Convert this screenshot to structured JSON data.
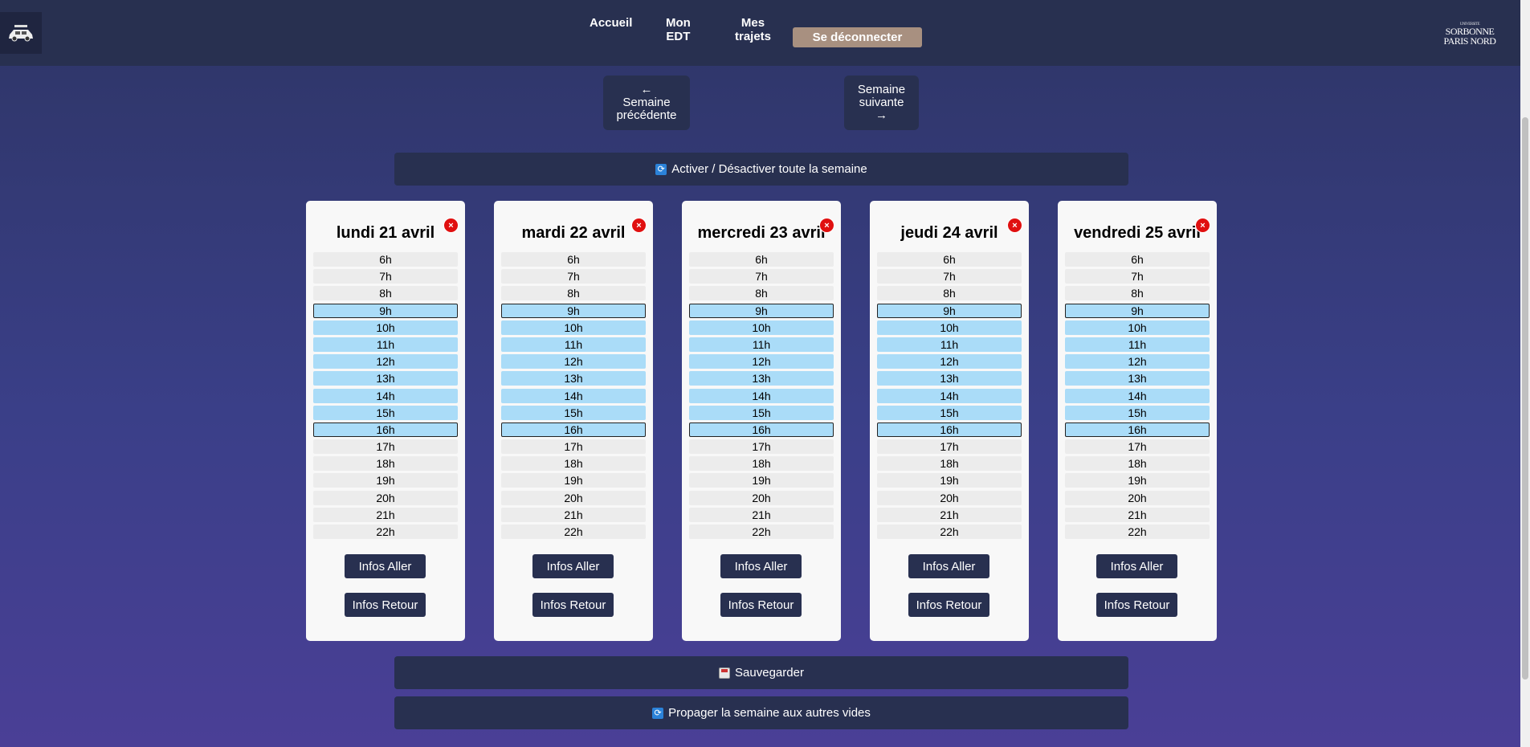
{
  "nav": {
    "home": "Accueil",
    "schedule_line1": "Mon",
    "schedule_line2": "EDT",
    "trips_line1": "Mes",
    "trips_line2": "trajets",
    "logout": "Se déconnecter"
  },
  "brand": {
    "line1": "SORBONNE",
    "line2": "PARIS NORD",
    "tiny": "UNIVERSITÉ"
  },
  "week": {
    "prev_arrow": "←",
    "prev_line1": "Semaine",
    "prev_line2": "précédente",
    "next_line1": "Semaine",
    "next_line2": "suivante",
    "next_arrow": "→"
  },
  "toggle_all": "Activer / Désactiver toute la semaine",
  "save": "Sauvegarder",
  "propagate": "Propager la semaine aux autres vides",
  "icons": {
    "refresh": "refresh-icon",
    "save": "floppy-disk-icon",
    "close": "close-icon",
    "logo": "car-logo-icon"
  },
  "days": [
    {
      "title": "lundi 21 avril"
    },
    {
      "title": "mardi 22 avril"
    },
    {
      "title": "mercredi 23 avril"
    },
    {
      "title": "jeudi 24 avril"
    },
    {
      "title": "vendredi 25 avril"
    }
  ],
  "hours": [
    "6h",
    "7h",
    "8h",
    "9h",
    "10h",
    "11h",
    "12h",
    "13h",
    "14h",
    "15h",
    "16h",
    "17h",
    "18h",
    "19h",
    "20h",
    "21h",
    "22h"
  ],
  "active_hours": [
    "9h",
    "10h",
    "11h",
    "12h",
    "13h",
    "14h",
    "15h",
    "16h"
  ],
  "edge_hours": [
    "9h",
    "16h"
  ],
  "info_go": "Infos Aller",
  "info_return": "Infos Retour",
  "colors": {
    "active_slot": "#aadcf8",
    "inactive_slot": "#ececec",
    "header": "#283050",
    "logout": "#a89080",
    "close": "#e01010"
  }
}
